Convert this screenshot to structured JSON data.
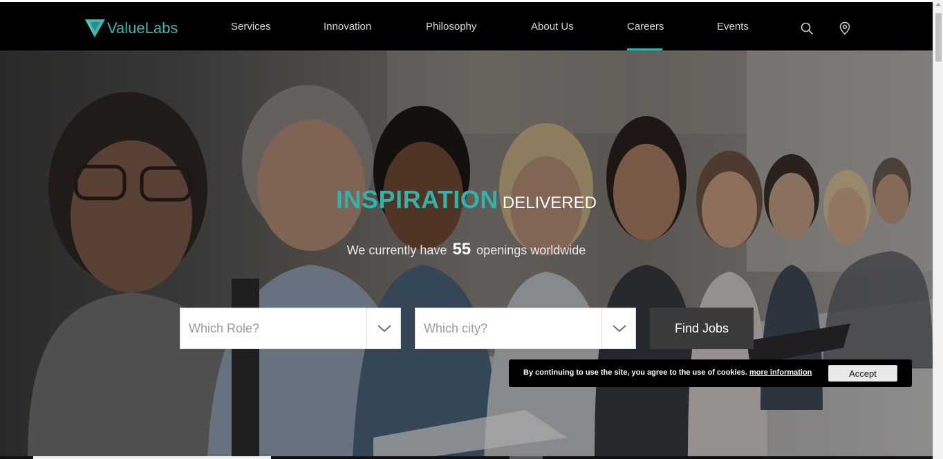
{
  "header": {
    "logo_text": "ValueLabs",
    "nav": [
      "Services",
      "Innovation",
      "Philosophy",
      "About Us",
      "Careers",
      "Events"
    ],
    "active_nav": "Careers",
    "accent_color": "#31b2a8"
  },
  "hero": {
    "headline_main": "INSPIRATION",
    "headline_sub": "DELIVERED",
    "openings_prefix": "We currently have",
    "openings_count": "55",
    "openings_suffix": "openings worldwide"
  },
  "search": {
    "role_placeholder": "Which Role?",
    "city_placeholder": "Which city?",
    "find_label": "Find Jobs"
  },
  "cookie": {
    "text": "By continuing to use the site, you agree to the use of cookies.",
    "link_text": "more information",
    "accept_label": "Accept"
  },
  "icons": [
    "logo-mark-icon",
    "search-icon",
    "location-pin-icon",
    "chevron-down-icon"
  ]
}
